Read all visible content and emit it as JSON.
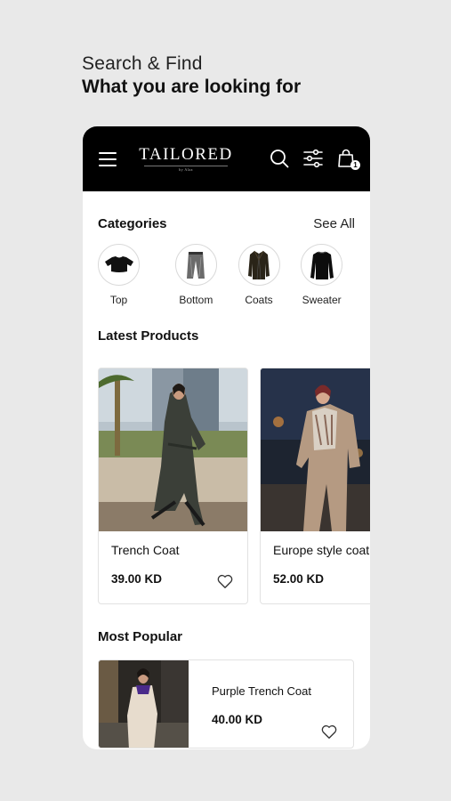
{
  "promo": {
    "line1": "Search & Find",
    "line2": "What you are looking for"
  },
  "header": {
    "brand": "TAILORED",
    "brand_sub": "by Alaa",
    "cart_count": "1"
  },
  "categories": {
    "title": "Categories",
    "see_all": "See All",
    "items": [
      {
        "label": "Top",
        "icon": "crop-top-icon"
      },
      {
        "label": "Bottom",
        "icon": "pants-icon"
      },
      {
        "label": "Coats",
        "icon": "coat-icon"
      },
      {
        "label": "Sweater",
        "icon": "sweater-icon"
      }
    ]
  },
  "latest": {
    "title": "Latest Products",
    "items": [
      {
        "name": "Trench Coat",
        "price": "39.00 KD"
      },
      {
        "name": "Europe style coat",
        "price": "52.00 KD"
      }
    ]
  },
  "popular": {
    "title": "Most Popular",
    "items": [
      {
        "name": "Purple Trench Coat",
        "price": "40.00 KD"
      }
    ]
  },
  "colors": {
    "background": "#e9e9e9",
    "header": "#000000",
    "card_border": "#e2e2e2"
  }
}
